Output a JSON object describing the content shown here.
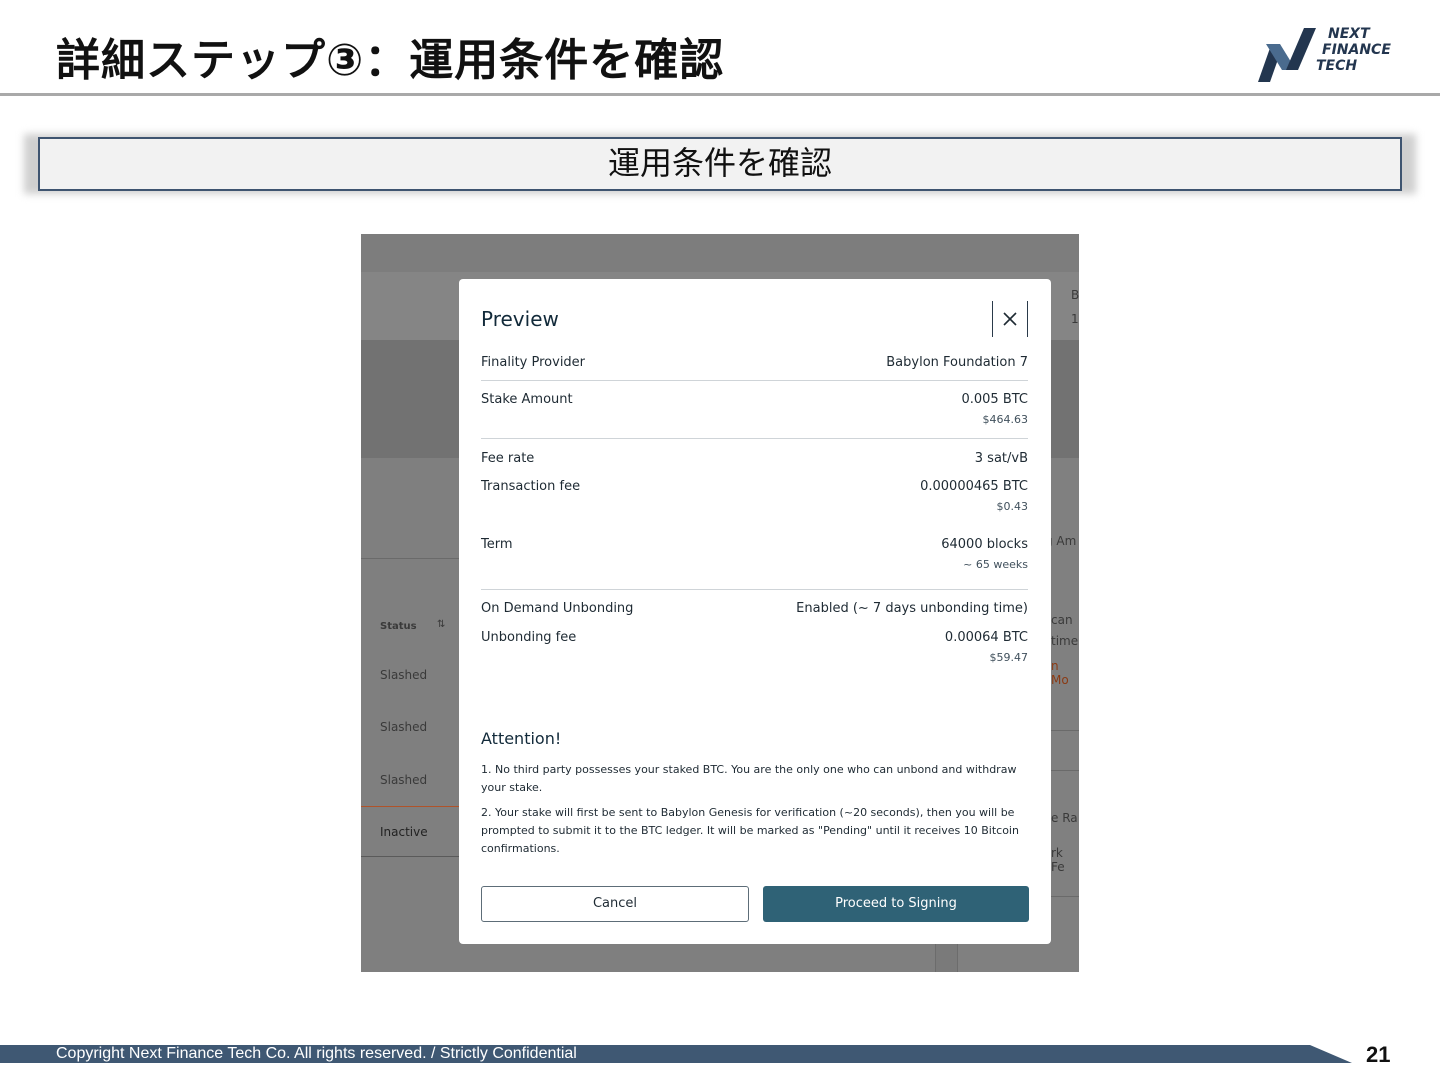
{
  "slide": {
    "title": "詳細ステップ③：運用条件を確認",
    "logo": {
      "line1": "NEXT",
      "line2": "FINANCE",
      "line3": "TECH"
    },
    "banner": "運用条件を確認",
    "footer": "Copyright Next Finance Tech Co. All rights reserved. / Strictly Confidential",
    "page_number": "21"
  },
  "background_app": {
    "status_header": "Status",
    "status_rows": [
      "Slashed",
      "Slashed",
      "Slashed",
      "Inactive"
    ],
    "right_fragments": [
      "B",
      "1",
      "g Am",
      "can",
      "time",
      "n Mo",
      "e Ra",
      "rk Fe"
    ]
  },
  "modal": {
    "title": "Preview",
    "rows": [
      {
        "label": "Finality Provider",
        "value": "Babylon Foundation 7",
        "sub": ""
      },
      {
        "label": "Stake Amount",
        "value": "0.005 BTC",
        "sub": "$464.63"
      },
      {
        "label": "Fee rate",
        "value": "3 sat/vB",
        "sub": ""
      },
      {
        "label": "Transaction fee",
        "value": "0.00000465 BTC",
        "sub": "$0.43"
      },
      {
        "label": "Term",
        "value": "64000 blocks",
        "sub": "~ 65 weeks"
      },
      {
        "label": "On Demand Unbonding",
        "value": "Enabled (~ 7 days unbonding time)",
        "sub": ""
      },
      {
        "label": "Unbonding fee",
        "value": "0.00064 BTC",
        "sub": "$59.47"
      }
    ],
    "attention_title": "Attention!",
    "attention_1": "1. No third party possesses your staked BTC. You are the only one who can unbond and withdraw your stake.",
    "attention_2": "2. Your stake will first be sent to Babylon Genesis for verification (~20 seconds), then you will be prompted to submit it to the BTC ledger. It will be marked as \"Pending\" until it receives 10 Bitcoin confirmations.",
    "cancel_label": "Cancel",
    "proceed_label": "Proceed to Signing"
  },
  "colors": {
    "accent": "#2f6276",
    "banner_border": "#3e5470",
    "footer_bar": "#3f5873"
  }
}
